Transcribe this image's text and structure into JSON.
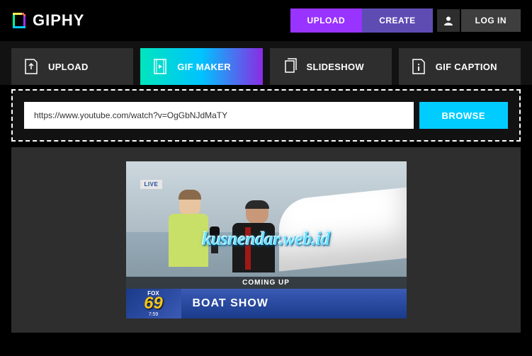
{
  "header": {
    "logo_text": "GIPHY",
    "upload_label": "UPLOAD",
    "create_label": "CREATE",
    "login_label": "LOG IN"
  },
  "tabs": {
    "upload": "UPLOAD",
    "gif_maker": "GIF MAKER",
    "slideshow": "SLIDESHOW",
    "gif_caption": "GIF CAPTION"
  },
  "input": {
    "url_value": "https://www.youtube.com/watch?v=OgGbNJdMaTY",
    "browse_label": "BROWSE"
  },
  "preview": {
    "live_badge": "LIVE",
    "watermark": "kusnendar.web.id",
    "coming_up": "COMING UP",
    "channel_network": "FOX",
    "channel_number": "69",
    "channel_time": "7:59",
    "headline": "BOAT SHOW"
  }
}
